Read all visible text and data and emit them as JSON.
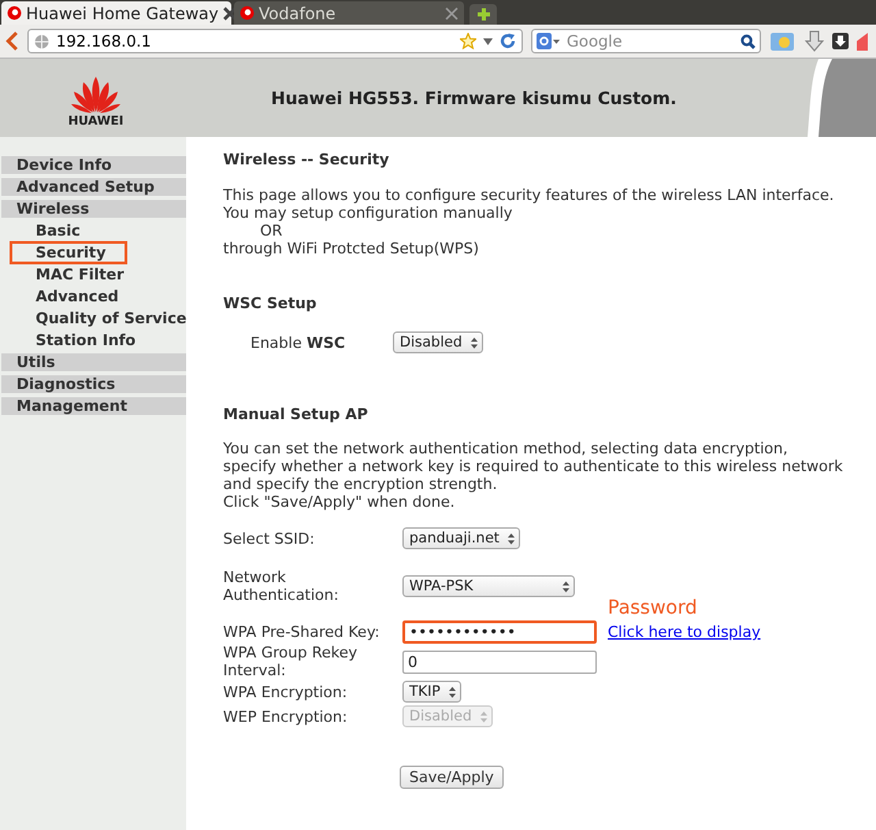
{
  "browser": {
    "tabs": [
      {
        "title": "Huawei Home Gateway",
        "selected": true
      },
      {
        "title": "Vodafone",
        "selected": false
      }
    ],
    "address": "192.168.0.1",
    "search_placeholder": "Google"
  },
  "header": {
    "logo_text": "HUAWEI",
    "title": "Huawei HG553. Firmware kisumu Custom."
  },
  "sidebar": {
    "items": [
      {
        "label": "Device Info",
        "selected": false
      },
      {
        "label": "Advanced Setup",
        "selected": false
      },
      {
        "label": "Wireless",
        "selected": false,
        "children": [
          {
            "label": "Basic",
            "selected": false
          },
          {
            "label": "Security",
            "selected": true
          },
          {
            "label": "MAC Filter",
            "selected": false
          },
          {
            "label": "Advanced",
            "selected": false
          },
          {
            "label": "Quality of Service",
            "selected": false
          },
          {
            "label": "Station Info",
            "selected": false
          }
        ]
      },
      {
        "label": "Utils",
        "selected": false
      },
      {
        "label": "Diagnostics",
        "selected": false
      },
      {
        "label": "Management",
        "selected": false
      }
    ]
  },
  "page": {
    "title": "Wireless -- Security",
    "intro": [
      "This page allows you to configure security features of the wireless LAN interface.",
      "You may setup configuration manually",
      "OR",
      "through WiFi Protcted Setup(WPS)"
    ],
    "wsc": {
      "title": "WSC Setup",
      "label": "Enable **WSC**",
      "value": "Disabled"
    },
    "manual": {
      "title": "Manual Setup AP",
      "description": [
        "You can set the network authentication method, selecting data encryption,",
        "specify whether a network key is required to authenticate to this wireless network",
        "and specify the encryption strength.",
        "Click \"Save/Apply\" when done."
      ],
      "fields": [
        {
          "kind": "select",
          "label": "Select SSID:",
          "value": "panduaji.net",
          "disabled": false
        },
        {
          "kind": "select",
          "label": "Network Authentication:",
          "value": "WPA-PSK",
          "disabled": false
        },
        {
          "kind": "password",
          "label": "WPA Pre-Shared Key:",
          "value": "••••••••••••",
          "highlighted": true,
          "link": "Click here to display",
          "annotation": "Password"
        },
        {
          "kind": "text",
          "label": "WPA Group Rekey Interval:",
          "value": "0",
          "highlighted": false
        },
        {
          "kind": "select",
          "label": "WPA Encryption:",
          "value": "TKIP",
          "disabled": false
        },
        {
          "kind": "select",
          "label": "WEP Encryption:",
          "value": "Disabled",
          "disabled": true
        }
      ],
      "save": "Save/Apply"
    }
  }
}
